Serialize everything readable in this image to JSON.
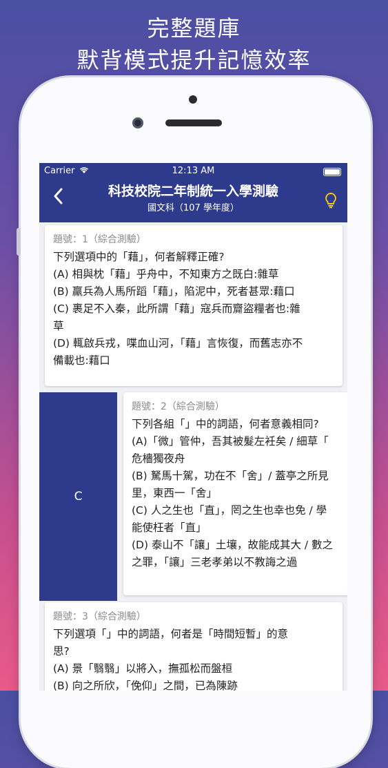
{
  "promo": {
    "line1": "完整題庫",
    "line2": "默背模式提升記憶效率"
  },
  "status_bar": {
    "carrier": "Carrier",
    "wifi_icon": "wifi-icon",
    "time": "12:13 AM",
    "battery_icon": "battery-icon"
  },
  "navbar": {
    "back_icon": "chevron-left-icon",
    "title": "科技校院二年制統一入學測驗",
    "subtitle": "國文科（107 學年度）",
    "hint_icon": "lightbulb-icon",
    "bg_color": "#2e3a8c",
    "accent_color": "#f5c518"
  },
  "questions": [
    {
      "number_label": "題號：1（綜合測驗）",
      "lines": [
        "下列選項中的「藉」，何者解釋正確?",
        "(A) 相與枕「藉」乎舟中，不知東方之既白:雜草",
        "(B) 羸兵為人馬所蹈「藉」，陷泥中，死者甚眾:藉口",
        "(C) 裹足不入秦，此所謂「藉」寇兵而齎盜糧者也:雜",
        "草",
        "(D) 輒啟兵戎，喋血山河，「藉」言恢復，而舊志亦不",
        "備載也:藉口"
      ]
    },
    {
      "number_label": "題號：2（綜合測驗）",
      "answer": "C",
      "lines": [
        "下列各組「」中的詞語，何者意義相同?",
        "(A)「微」管仲，吾其被髮左衽矣 / 細草「",
        "危檣獨夜舟",
        "(B) 駑馬十駕，功在不「舍」/ 蓋亭之所見",
        "里，東西一「舍」",
        "(C) 人之生也「直」，罔之生也幸也免 / 學",
        "能使枉者「直」",
        "(D) 泰山不「讓」土壤，故能成其大 / 數之",
        "之罪，「讓」三老孝弟以不教誨之過"
      ]
    },
    {
      "number_label": "題號：3（綜合測驗）",
      "lines": [
        "下列選項「」中的詞語，何者是「時間短暫」的意",
        "思?",
        "(A) 景「翳翳」以將入，撫孤松而盤桓",
        "(B) 向之所欣，「俛仰」之間，已為陳跡"
      ]
    }
  ]
}
